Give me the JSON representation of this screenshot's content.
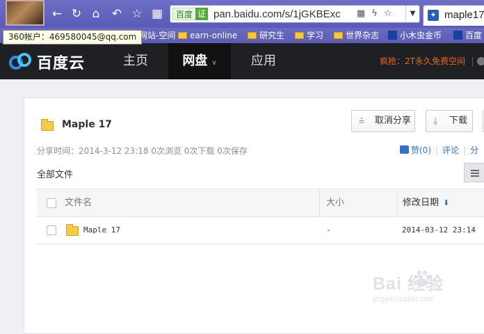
{
  "browser": {
    "nav_icons": [
      "back-icon",
      "refresh-icon",
      "home-icon",
      "undo-icon",
      "star-icon",
      "grid-icon"
    ],
    "address": {
      "badge": "百度",
      "cert": "证",
      "url": "pan.baidu.com/s/1jGKBExc"
    },
    "tab": {
      "label": "maple17"
    },
    "tooltip": "360帐户：469580045@qq.com"
  },
  "bookmarks": [
    {
      "label": "网站-空间",
      "icon": "folder-icon"
    },
    {
      "label": "earn-online",
      "icon": "folder-icon"
    },
    {
      "label": "研究生",
      "icon": "folder-icon"
    },
    {
      "label": "学习",
      "icon": "folder-icon"
    },
    {
      "label": "世界杂志",
      "icon": "folder-icon"
    },
    {
      "label": "小木虫金币",
      "icon": "app-icon"
    },
    {
      "label": "百度",
      "icon": "paw-icon"
    }
  ],
  "site": {
    "logo": "百度云",
    "nav": [
      {
        "label": "主页"
      },
      {
        "label": "网盘",
        "active": true
      },
      {
        "label": "应用"
      }
    ],
    "promo": "疯抢：2T永久免费空间"
  },
  "share": {
    "title": "Maple 17",
    "cancel_share_label": "取消分享",
    "download_label": "下载",
    "meta": "分享时间：2014-3-12 23:18  0次浏览  0次下载  0次保存",
    "like": "赞(0)",
    "comment": "评论",
    "share": "分",
    "all_files": "全部文件"
  },
  "table": {
    "headers": {
      "name": "文件名",
      "size": "大小",
      "date": "修改日期"
    },
    "rows": [
      {
        "name": "Maple 17",
        "size": "-",
        "date": "2014-03-12 23:14"
      }
    ]
  },
  "watermark": {
    "main": "Bai  经验",
    "sub": "jingyan.baidu.com"
  },
  "colors": {
    "accent": "#3170c8",
    "header_bg": "#1f2024",
    "promo": "#e06a22",
    "folder": "#f6c94a"
  }
}
